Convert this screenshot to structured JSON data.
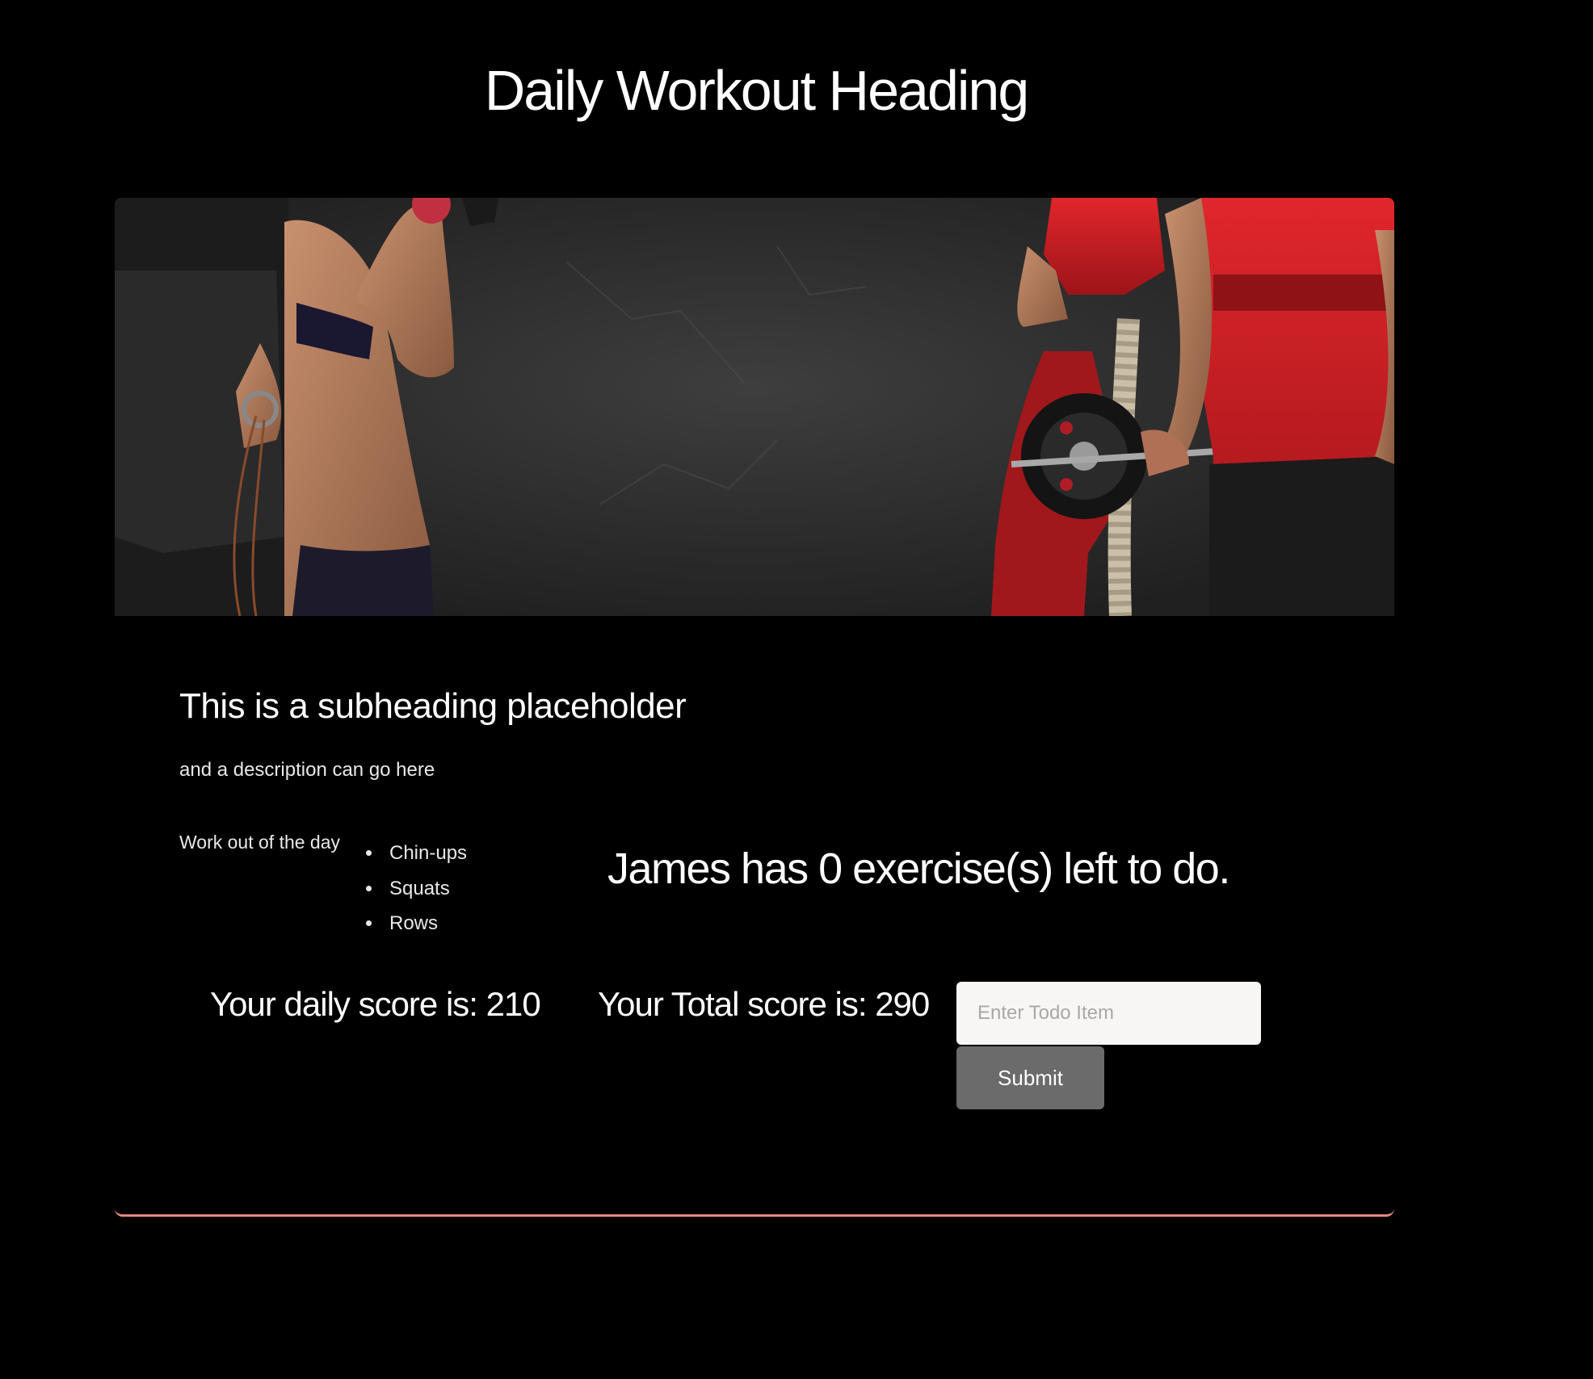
{
  "header": {
    "title": "Daily Workout Heading"
  },
  "hero": {
    "alt": "fitness banner photo with athletes",
    "accent_color": "#d9262c"
  },
  "content": {
    "subheading": "This is a subheading placeholder",
    "description": "and a description can go here",
    "workout_label": "Work out of the day",
    "exercises": [
      "Chin-ups",
      "Squats",
      "Rows"
    ],
    "remaining_message": "James has 0 exercise(s) left to do."
  },
  "scores": {
    "daily": "Your daily score is: 210",
    "total": "Your Total score is: 290"
  },
  "todo": {
    "placeholder": "Enter Todo Item",
    "value": "",
    "submit_label": "Submit"
  },
  "colors": {
    "background": "#000000",
    "card_border": "#e28a80",
    "submit_button": "#6b6b6b",
    "input_background": "#f7f6f5"
  }
}
